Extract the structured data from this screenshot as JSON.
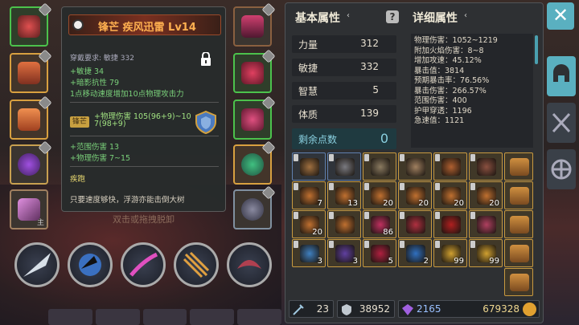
{
  "tooltip": {
    "title": "锋芒 疾风迅雷 Lv14",
    "requirement": "穿戴要求:  敏捷 332",
    "lines": [
      "+敏捷 34",
      "+暗影抗性 79",
      "1点移动速度增加10点物理攻击力"
    ],
    "badge": "锋芒",
    "phys_damage_line1": "+物理伤害 105(96+9)~10",
    "phys_damage_line2": "7(98+9)",
    "range_damage": "+范围伤害 13",
    "phys_damage2": "+物理伤害 7~15",
    "skill_name": "疾跑",
    "skill_desc": "只要速度够快，浮游亦能击倒大树"
  },
  "background_label": "双击或拖拽脱卸",
  "equipment_level_label": "主",
  "stats_panel": {
    "basic_title": "基本属性",
    "detail_title": "详细属性",
    "basic": [
      {
        "label": "力量",
        "value": "312"
      },
      {
        "label": "敏捷",
        "value": "332"
      },
      {
        "label": "智慧",
        "value": "5"
      },
      {
        "label": "体质",
        "value": "139"
      }
    ],
    "remaining_label": "剩余点数",
    "remaining_value": "0",
    "details": [
      "物理伤害：1052~1219",
      "附加火焰伤害：8~8",
      "增加攻速：45.12%",
      "暴击值：3814",
      "预期暴击率：76.56%",
      "暴击伤害：266.57%",
      "范围伤害：400",
      "护甲穿透：1196",
      "急速值：1121"
    ]
  },
  "inventory": [
    {
      "q": ""
    },
    {
      "q": ""
    },
    {
      "q": ""
    },
    {
      "q": ""
    },
    {
      "q": ""
    },
    {
      "q": ""
    },
    {
      "q": "7"
    },
    {
      "q": "13"
    },
    {
      "q": "20"
    },
    {
      "q": "20"
    },
    {
      "q": "20"
    },
    {
      "q": "20"
    },
    {
      "q": "20"
    },
    {
      "q": ""
    },
    {
      "q": "86"
    },
    {
      "q": ""
    },
    {
      "q": ""
    },
    {
      "q": ""
    },
    {
      "q": "3"
    },
    {
      "q": "3"
    },
    {
      "q": "5"
    },
    {
      "q": "2"
    },
    {
      "q": "99"
    },
    {
      "q": "99"
    }
  ],
  "bottom_bar": {
    "energy": "23",
    "silver": "38952",
    "gems": "2165",
    "gold": "679328"
  },
  "colors": {
    "accent": "#5ab0c0",
    "title_orange": "#ffb050",
    "green_stat": "#7ad07a"
  }
}
